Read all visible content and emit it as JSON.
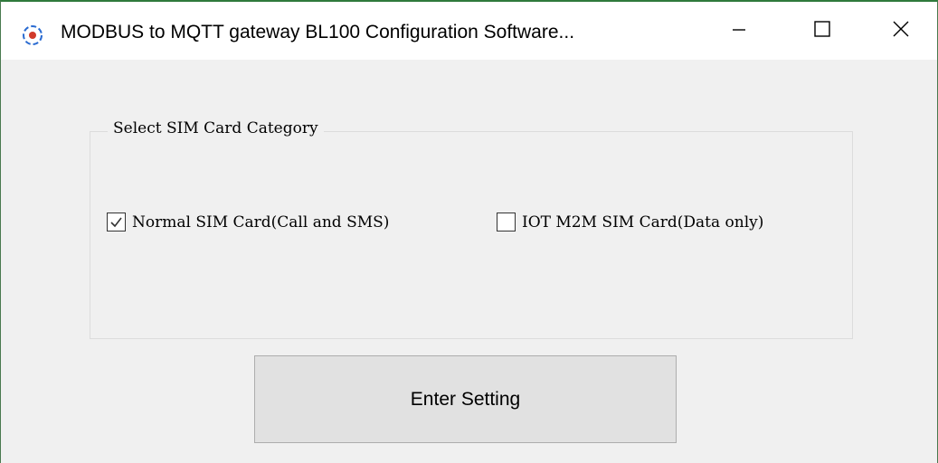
{
  "window": {
    "title": "MODBUS to MQTT gateway BL100 Configuration Software...",
    "app_icon": "app-logo-icon",
    "controls": {
      "minimize_icon": "minimize-icon",
      "maximize_icon": "maximize-icon",
      "close_icon": "close-icon"
    }
  },
  "group": {
    "legend": "Select SIM Card Category",
    "options": [
      {
        "label": "Normal SIM Card(Call and SMS)",
        "checked": true
      },
      {
        "label": "IOT M2M SIM Card(Data only)",
        "checked": false
      }
    ]
  },
  "enter_button": {
    "label": "Enter Setting"
  },
  "colors": {
    "title_bar": "#ffffff",
    "client_area": "#f0f0f0",
    "button_face": "#e1e1e1",
    "window_border": "#2f7a3c"
  }
}
